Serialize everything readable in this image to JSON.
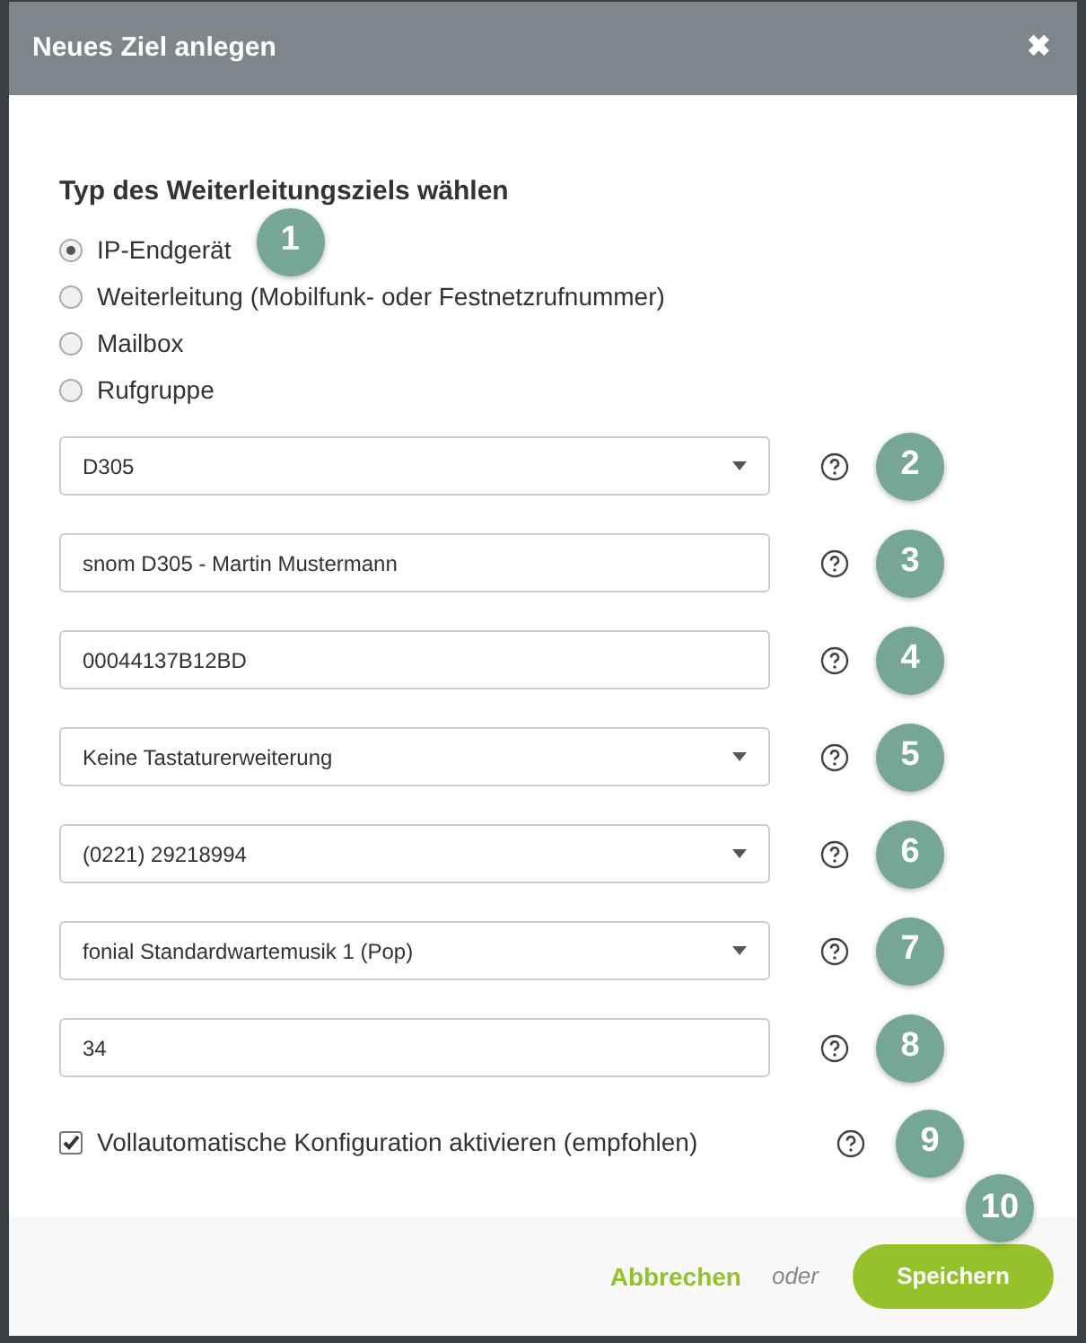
{
  "dialog": {
    "title": "Neues Ziel anlegen",
    "close": "✖"
  },
  "type_section": {
    "heading": "Typ des Weiterleitungsziels wählen",
    "badge": "1",
    "options": [
      {
        "label": "IP-Endgerät",
        "selected": true
      },
      {
        "label": "Weiterleitung (Mobilfunk- oder Festnetzrufnummer)",
        "selected": false
      },
      {
        "label": "Mailbox",
        "selected": false
      },
      {
        "label": "Rufgruppe",
        "selected": false
      }
    ]
  },
  "fields": [
    {
      "kind": "select",
      "value": "D305",
      "badge": "2"
    },
    {
      "kind": "input",
      "value": "snom D305 - Martin Mustermann",
      "badge": "3"
    },
    {
      "kind": "input",
      "value": "00044137B12BD",
      "badge": "4"
    },
    {
      "kind": "select",
      "value": "Keine Tastaturerweiterung",
      "badge": "5"
    },
    {
      "kind": "select",
      "value": "(0221) 29218994",
      "badge": "6"
    },
    {
      "kind": "select",
      "value": "fonial Standardwartemusik 1 (Pop)",
      "badge": "7"
    },
    {
      "kind": "input",
      "value": "34",
      "badge": "8"
    }
  ],
  "auto_config": {
    "label": "Vollautomatische Konfiguration aktivieren (empfohlen)",
    "checked": true,
    "badge": "9"
  },
  "footer": {
    "cancel": "Abbrechen",
    "or": "oder",
    "save": "Speichern",
    "badge": "10"
  }
}
